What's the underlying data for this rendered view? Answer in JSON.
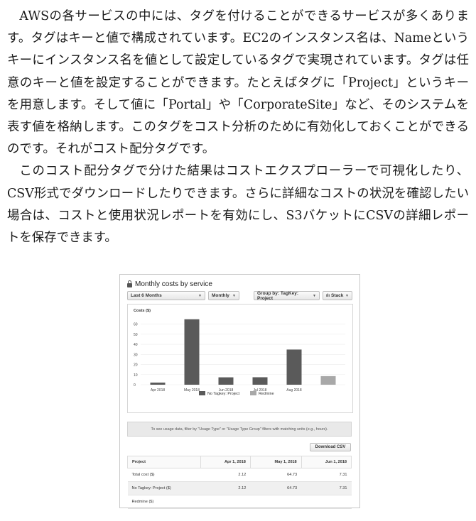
{
  "article": {
    "paragraphs": [
      "AWSの各サービスの中には、タグを付けることができるサービスが多くあります。タグはキーと値で構成されています。EC2のインスタンス名は、Nameというキーにインスタンス名を値として設定しているタグで実現されています。タグは任意のキーと値を設定することができます。たとえばタグに「Project」というキーを用意します。そして値に「Portal」や「CorporateSite」など、そのシステムを表す値を格納します。このタグをコスト分析のために有効化しておくことができるのです。それがコスト配分タグです。",
      "このコスト配分タグで分けた結果はコストエクスプローラーで可視化したり、CSV形式でダウンロードしたりできます。さらに詳細なコストの状況を確認したい場合は、コストと使用状況レポートを有効にし、S3バケットにCSVの詳細レポートを保存できます。"
    ]
  },
  "screenshot": {
    "title": "Monthly costs by service",
    "range_dropdown": "Last 6 Months",
    "granularity_dropdown": "Monthly",
    "group_dropdown": "Group by: TagKey: Project",
    "chart_style_dropdown": "Stack",
    "hint": "To see usage data, filter by \"Usage Type\" or \"Usage Type Group\" filters with matching units (e.g., hours).",
    "download_button": "Download CSV",
    "table": {
      "headers": [
        "Project",
        "Apr 1, 2018",
        "May 1, 2018",
        "Jun 1, 2018"
      ],
      "rows": [
        [
          "Total cost ($)",
          "2.12",
          "64.73",
          "7.31"
        ],
        [
          "No Tagkey: Project ($)",
          "2.12",
          "64.73",
          "7.31"
        ],
        [
          "Redmine ($)",
          "",
          "",
          ""
        ]
      ]
    }
  },
  "colors": {
    "series_no_tag": "#5a5a5a",
    "series_redmine": "#a8a8a8"
  },
  "chart_data": {
    "type": "bar",
    "ylabel": "Costs ($)",
    "ylim": [
      0,
      60
    ],
    "yticks": [
      0,
      10,
      20,
      30,
      40,
      50,
      60
    ],
    "categories": [
      "Apr 2018",
      "May 2018",
      "Jun 2018",
      "Jul 2018",
      "Aug 2018",
      ""
    ],
    "series": [
      {
        "name": "No Tagkey: Project",
        "values": [
          2.12,
          64.73,
          7.31,
          7.4,
          34.8,
          0
        ]
      },
      {
        "name": "Redmine",
        "values": [
          0,
          0,
          0,
          0,
          0,
          8.5
        ]
      }
    ],
    "legend": "bottom",
    "grid": true
  }
}
